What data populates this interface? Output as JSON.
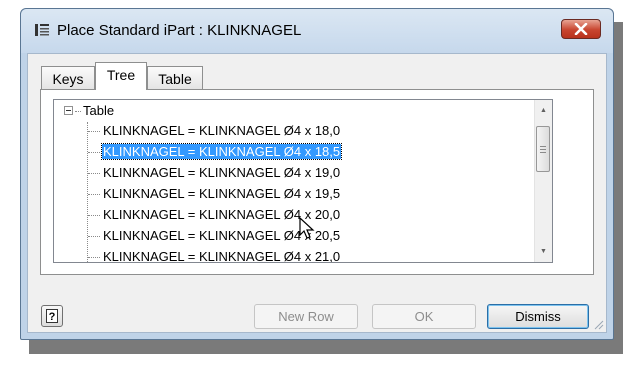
{
  "window": {
    "title": "Place Standard iPart : KLINKNAGEL"
  },
  "tabs": [
    {
      "label": "Keys",
      "active": false
    },
    {
      "label": "Tree",
      "active": true
    },
    {
      "label": "Table",
      "active": false
    }
  ],
  "tree": {
    "root_label": "Table",
    "items": [
      {
        "label": "KLINKNAGEL = KLINKNAGEL Ø4 x 18,0",
        "selected": false
      },
      {
        "label": "KLINKNAGEL = KLINKNAGEL Ø4 x 18,5",
        "selected": true
      },
      {
        "label": "KLINKNAGEL = KLINKNAGEL Ø4 x 19,0",
        "selected": false
      },
      {
        "label": "KLINKNAGEL = KLINKNAGEL Ø4 x 19,5",
        "selected": false
      },
      {
        "label": "KLINKNAGEL = KLINKNAGEL Ø4 x 20,0",
        "selected": false
      },
      {
        "label": "KLINKNAGEL = KLINKNAGEL Ø4 x 20,5",
        "selected": false
      },
      {
        "label": "KLINKNAGEL = KLINKNAGEL Ø4 x 21,0",
        "selected": false
      }
    ]
  },
  "buttons": {
    "help_label": "?",
    "new_row_label": "New Row",
    "ok_label": "OK",
    "dismiss_label": "Dismiss"
  },
  "colors": {
    "selection": "#3399ff",
    "close_button": "#c8452f",
    "window_frame": "#bfd3e8"
  }
}
